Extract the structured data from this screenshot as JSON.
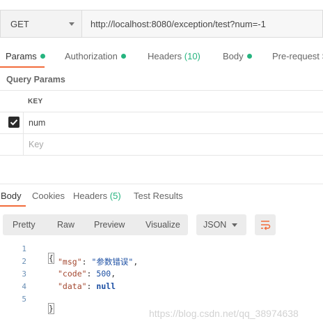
{
  "request": {
    "method": "GET",
    "url": "http://localhost:8080/exception/test?num=-1"
  },
  "request_tabs": [
    {
      "label": "Params",
      "dot": true,
      "active": true
    },
    {
      "label": "Authorization",
      "dot": true
    },
    {
      "label": "Headers",
      "count": "(10)"
    },
    {
      "label": "Body",
      "dot": true
    },
    {
      "label": "Pre-request S"
    }
  ],
  "query_params": {
    "title": "Query Params",
    "column_key": "KEY",
    "rows": [
      {
        "checked": true,
        "key": "num"
      }
    ],
    "new_key_placeholder": "Key"
  },
  "response_tabs": [
    {
      "label": "Body",
      "active": true
    },
    {
      "label": "Cookies"
    },
    {
      "label": "Headers",
      "count": "(5)"
    },
    {
      "label": "Test Results"
    }
  ],
  "view_modes": [
    "Pretty",
    "Raw",
    "Preview",
    "Visualize"
  ],
  "format": "JSON",
  "icons": {
    "method_dropdown": "chevron-down-icon",
    "checkbox": "checkmark-icon",
    "format_dropdown": "chevron-down-icon",
    "wrap": "wrap-lines-icon"
  },
  "colors": {
    "accent": "#f26b3a",
    "status_dot": "#26b47f",
    "json_key": "#a3472f",
    "json_value": "#1c4fa3"
  },
  "response_body": {
    "line_numbers": [
      "1",
      "2",
      "3",
      "4",
      "5"
    ],
    "open_brace": "{",
    "close_brace": "}",
    "entries": [
      {
        "key": "\"msg\"",
        "value": "\"参数错误\"",
        "sep": ","
      },
      {
        "key": "\"code\"",
        "value": "500",
        "sep": ","
      },
      {
        "key": "\"data\"",
        "value": "null",
        "sep": ""
      }
    ]
  },
  "watermark": "https://blog.csdn.net/qq_38974638"
}
